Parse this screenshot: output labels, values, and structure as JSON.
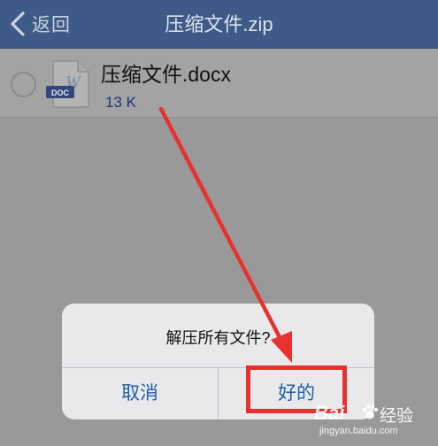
{
  "nav": {
    "back_label": "返回",
    "title": "压缩文件.zip"
  },
  "file": {
    "name": "压缩文件.docx",
    "size": "13 K",
    "icon_badge": "DOC",
    "icon_letter": "W"
  },
  "alert": {
    "message": "解压所有文件?",
    "cancel_label": "取消",
    "ok_label": "好的"
  },
  "annotation": {
    "color": "#e8312f"
  },
  "watermark": {
    "brand": "Bai",
    "brand_cn": "经验",
    "url": "jingyan.baidu.com"
  },
  "colors": {
    "nav_bar": "#3e5a86",
    "button_text": "#1f5fa8",
    "alert_bg": "#e9e9ec"
  }
}
